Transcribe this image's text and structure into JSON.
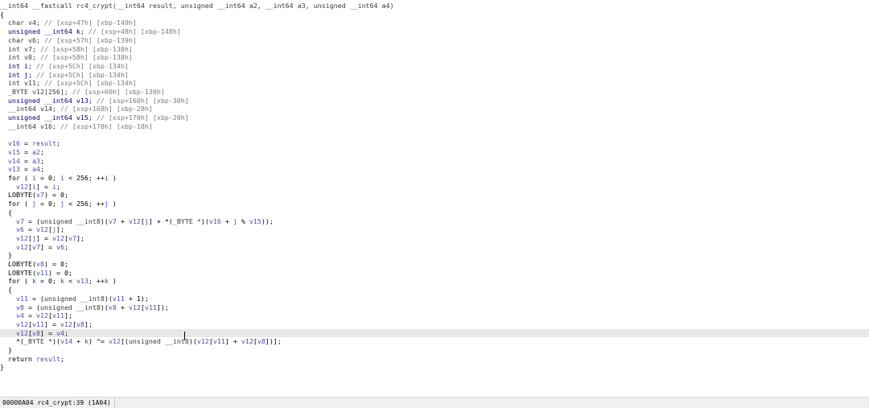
{
  "editor": {
    "lines": [
      {
        "hl": false,
        "tokens": [
          [
            "x",
            "__int64 __fastcall rc4_crypt(__int64 result, unsigned __int64 a2, __int64 a3, unsigned __int64 a4)"
          ]
        ]
      },
      {
        "hl": false,
        "tokens": [
          [
            "p",
            "{"
          ]
        ]
      },
      {
        "hl": false,
        "tokens": [
          [
            "x",
            "  char v4; "
          ],
          [
            "c",
            "// [xsp+47h] [xbp-149h]"
          ]
        ]
      },
      {
        "hl": false,
        "tokens": [
          [
            "k",
            "  unsigned __int64 k; "
          ],
          [
            "c",
            "// [xsp+48h] [xbp-148h]"
          ]
        ]
      },
      {
        "hl": false,
        "tokens": [
          [
            "x",
            "  char v6; "
          ],
          [
            "c",
            "// [xsp+57h] [xbp-139h]"
          ]
        ]
      },
      {
        "hl": false,
        "tokens": [
          [
            "x",
            "  int v7; "
          ],
          [
            "c",
            "// [xsp+58h] [xbp-138h]"
          ]
        ]
      },
      {
        "hl": false,
        "tokens": [
          [
            "x",
            "  int v8; "
          ],
          [
            "c",
            "// [xsp+58h] [xbp-138h]"
          ]
        ]
      },
      {
        "hl": false,
        "tokens": [
          [
            "k",
            "  int i; "
          ],
          [
            "c",
            "// [xsp+5Ch] [xbp-134h]"
          ]
        ]
      },
      {
        "hl": false,
        "tokens": [
          [
            "k",
            "  int j; "
          ],
          [
            "c",
            "// [xsp+5Ch] [xbp-134h]"
          ]
        ]
      },
      {
        "hl": false,
        "tokens": [
          [
            "x",
            "  int v11; "
          ],
          [
            "c",
            "// [xsp+5Ch] [xbp-134h]"
          ]
        ]
      },
      {
        "hl": false,
        "tokens": [
          [
            "x",
            "  _BYTE v12[256]; "
          ],
          [
            "c",
            "// [xsp+60h] [xbp-130h]"
          ]
        ]
      },
      {
        "hl": false,
        "tokens": [
          [
            "k",
            "  unsigned __int64 v13; "
          ],
          [
            "c",
            "// [xsp+160h] [xbp-30h]"
          ]
        ]
      },
      {
        "hl": false,
        "tokens": [
          [
            "x",
            "  __int64 v14; "
          ],
          [
            "c",
            "// [xsp+168h] [xbp-28h]"
          ]
        ]
      },
      {
        "hl": false,
        "tokens": [
          [
            "k",
            "  unsigned __int64 v15; "
          ],
          [
            "c",
            "// [xsp+170h] [xbp-20h]"
          ]
        ]
      },
      {
        "hl": false,
        "tokens": [
          [
            "x",
            "  __int64 v16; "
          ],
          [
            "c",
            "// [xsp+178h] [xbp-18h]"
          ]
        ]
      },
      {
        "hl": false,
        "tokens": [
          [
            "p",
            ""
          ]
        ]
      },
      {
        "hl": false,
        "tokens": [
          [
            "v",
            "  v16"
          ],
          [
            "p",
            " = "
          ],
          [
            "v",
            "result"
          ],
          [
            "p",
            ";"
          ]
        ]
      },
      {
        "hl": false,
        "tokens": [
          [
            "v",
            "  v15"
          ],
          [
            "p",
            " = "
          ],
          [
            "v",
            "a2"
          ],
          [
            "p",
            ";"
          ]
        ]
      },
      {
        "hl": false,
        "tokens": [
          [
            "v",
            "  v14"
          ],
          [
            "p",
            " = "
          ],
          [
            "v",
            "a3"
          ],
          [
            "p",
            ";"
          ]
        ]
      },
      {
        "hl": false,
        "tokens": [
          [
            "v",
            "  v13"
          ],
          [
            "p",
            " = "
          ],
          [
            "v",
            "a4"
          ],
          [
            "p",
            ";"
          ]
        ]
      },
      {
        "hl": false,
        "tokens": [
          [
            "p",
            "  for ( "
          ],
          [
            "v",
            "i"
          ],
          [
            "p",
            " = 0; "
          ],
          [
            "v",
            "i"
          ],
          [
            "p",
            " < 256; ++"
          ],
          [
            "v",
            "i"
          ],
          [
            "p",
            " )"
          ]
        ]
      },
      {
        "hl": false,
        "tokens": [
          [
            "v",
            "    v12"
          ],
          [
            "p",
            "["
          ],
          [
            "v",
            "i"
          ],
          [
            "p",
            "] = "
          ],
          [
            "v",
            "i"
          ],
          [
            "p",
            ";"
          ]
        ]
      },
      {
        "hl": false,
        "tokens": [
          [
            "p",
            "  LOBYTE("
          ],
          [
            "v",
            "v7"
          ],
          [
            "p",
            ") = 0;"
          ]
        ]
      },
      {
        "hl": false,
        "tokens": [
          [
            "p",
            "  for ( "
          ],
          [
            "v",
            "j"
          ],
          [
            "p",
            " = 0; "
          ],
          [
            "v",
            "j"
          ],
          [
            "p",
            " < 256; ++"
          ],
          [
            "v",
            "j"
          ],
          [
            "p",
            " )"
          ]
        ]
      },
      {
        "hl": false,
        "tokens": [
          [
            "p",
            "  {"
          ]
        ]
      },
      {
        "hl": false,
        "tokens": [
          [
            "v",
            "    v7"
          ],
          [
            "p",
            " = ("
          ],
          [
            "x",
            "unsigned __int8"
          ],
          [
            "p",
            ")("
          ],
          [
            "v",
            "v7"
          ],
          [
            "p",
            " + "
          ],
          [
            "v",
            "v12"
          ],
          [
            "p",
            "["
          ],
          [
            "v",
            "j"
          ],
          [
            "p",
            "] + *("
          ],
          [
            "x",
            "_BYTE *"
          ],
          [
            "p",
            ")("
          ],
          [
            "v",
            "v16"
          ],
          [
            "p",
            " + "
          ],
          [
            "v",
            "j"
          ],
          [
            "p",
            " % "
          ],
          [
            "v",
            "v15"
          ],
          [
            "p",
            "));"
          ]
        ]
      },
      {
        "hl": false,
        "tokens": [
          [
            "v",
            "    v6"
          ],
          [
            "p",
            " = "
          ],
          [
            "v",
            "v12"
          ],
          [
            "p",
            "["
          ],
          [
            "v",
            "j"
          ],
          [
            "p",
            "];"
          ]
        ]
      },
      {
        "hl": false,
        "tokens": [
          [
            "v",
            "    v12"
          ],
          [
            "p",
            "["
          ],
          [
            "v",
            "j"
          ],
          [
            "p",
            "] = "
          ],
          [
            "v",
            "v12"
          ],
          [
            "p",
            "["
          ],
          [
            "v",
            "v7"
          ],
          [
            "p",
            "];"
          ]
        ]
      },
      {
        "hl": false,
        "tokens": [
          [
            "v",
            "    v12"
          ],
          [
            "p",
            "["
          ],
          [
            "v",
            "v7"
          ],
          [
            "p",
            "] = "
          ],
          [
            "v",
            "v6"
          ],
          [
            "p",
            ";"
          ]
        ]
      },
      {
        "hl": false,
        "tokens": [
          [
            "p",
            "  }"
          ]
        ]
      },
      {
        "hl": false,
        "tokens": [
          [
            "p",
            "  LOBYTE("
          ],
          [
            "v",
            "v8"
          ],
          [
            "p",
            ") = 0;"
          ]
        ]
      },
      {
        "hl": false,
        "tokens": [
          [
            "p",
            "  LOBYTE("
          ],
          [
            "v",
            "v11"
          ],
          [
            "p",
            ") = 0;"
          ]
        ]
      },
      {
        "hl": false,
        "tokens": [
          [
            "p",
            "  for ( "
          ],
          [
            "v",
            "k"
          ],
          [
            "p",
            " = 0; "
          ],
          [
            "v",
            "k"
          ],
          [
            "p",
            " < "
          ],
          [
            "v",
            "v13"
          ],
          [
            "p",
            "; ++"
          ],
          [
            "v",
            "k"
          ],
          [
            "p",
            " )"
          ]
        ]
      },
      {
        "hl": false,
        "tokens": [
          [
            "p",
            "  {"
          ]
        ]
      },
      {
        "hl": false,
        "tokens": [
          [
            "v",
            "    v11"
          ],
          [
            "p",
            " = ("
          ],
          [
            "x",
            "unsigned __int8"
          ],
          [
            "p",
            ")("
          ],
          [
            "v",
            "v11"
          ],
          [
            "p",
            " + 1);"
          ]
        ]
      },
      {
        "hl": false,
        "tokens": [
          [
            "v",
            "    v8"
          ],
          [
            "p",
            " = ("
          ],
          [
            "x",
            "unsigned __int8"
          ],
          [
            "p",
            ")("
          ],
          [
            "v",
            "v8"
          ],
          [
            "p",
            " + "
          ],
          [
            "v",
            "v12"
          ],
          [
            "p",
            "["
          ],
          [
            "v",
            "v11"
          ],
          [
            "p",
            "]);"
          ]
        ]
      },
      {
        "hl": false,
        "tokens": [
          [
            "v",
            "    v4"
          ],
          [
            "p",
            " = "
          ],
          [
            "v",
            "v12"
          ],
          [
            "p",
            "["
          ],
          [
            "v",
            "v11"
          ],
          [
            "p",
            "];"
          ]
        ]
      },
      {
        "hl": false,
        "tokens": [
          [
            "v",
            "    v12"
          ],
          [
            "p",
            "["
          ],
          [
            "v",
            "v11"
          ],
          [
            "p",
            "] = "
          ],
          [
            "v",
            "v12"
          ],
          [
            "p",
            "["
          ],
          [
            "v",
            "v8"
          ],
          [
            "p",
            "];"
          ]
        ]
      },
      {
        "hl": true,
        "tokens": [
          [
            "v",
            "    v12"
          ],
          [
            "p",
            "["
          ],
          [
            "v",
            "v8"
          ],
          [
            "p",
            "] = "
          ],
          [
            "v",
            "v4"
          ],
          [
            "p",
            ";"
          ]
        ]
      },
      {
        "hl": false,
        "tokens": [
          [
            "p",
            "    *("
          ],
          [
            "x",
            "_BYTE *"
          ],
          [
            "p",
            ")("
          ],
          [
            "v",
            "v14"
          ],
          [
            "p",
            " + "
          ],
          [
            "v",
            "k"
          ],
          [
            "p",
            ") ^= "
          ],
          [
            "v",
            "v12"
          ],
          [
            "p",
            "[("
          ],
          [
            "x",
            "unsigned __int8"
          ],
          [
            "p",
            ")("
          ],
          [
            "v",
            "v12"
          ],
          [
            "p",
            "["
          ],
          [
            "v",
            "v11"
          ],
          [
            "p",
            "] + "
          ],
          [
            "v",
            "v12"
          ],
          [
            "p",
            "["
          ],
          [
            "v",
            "v8"
          ],
          [
            "p",
            "])];"
          ]
        ]
      },
      {
        "hl": false,
        "tokens": [
          [
            "p",
            "  }"
          ]
        ]
      },
      {
        "hl": false,
        "tokens": [
          [
            "p",
            "  return "
          ],
          [
            "v",
            "result"
          ],
          [
            "p",
            ";"
          ]
        ]
      },
      {
        "hl": false,
        "tokens": [
          [
            "p",
            "}"
          ]
        ]
      }
    ]
  },
  "statusbar": {
    "text": "00000A04 rc4_crypt:39 (1A04)"
  }
}
